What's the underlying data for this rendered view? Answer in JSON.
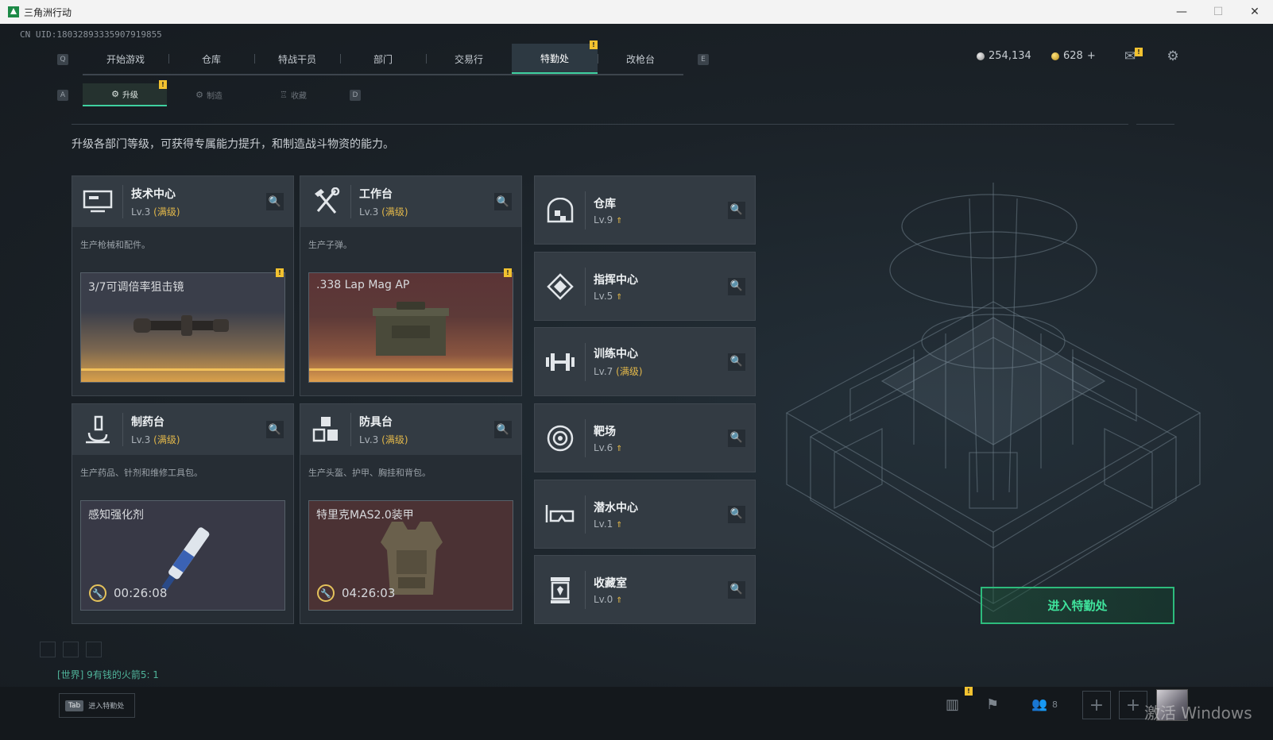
{
  "window": {
    "title": "三角洲行动",
    "minimize": "—",
    "maximize": "☐",
    "close": "✕"
  },
  "uid": "CN UID:18032893335907919855",
  "nav": {
    "left_key": "Q",
    "right_key": "E",
    "tabs": [
      {
        "label": "开始游戏"
      },
      {
        "label": "仓库"
      },
      {
        "label": "特战干员"
      },
      {
        "label": "部门"
      },
      {
        "label": "交易行"
      },
      {
        "label": "特勤处",
        "active": true,
        "badge": "!"
      },
      {
        "label": "改枪台"
      }
    ]
  },
  "currency": {
    "silver": "254,134",
    "gold": "628",
    "gold_add": "+"
  },
  "mail_badge": "!",
  "subnav": {
    "left_key": "A",
    "right_key": "D",
    "tabs": [
      {
        "label": "升级",
        "active": true,
        "badge": "!"
      },
      {
        "label": "制造"
      },
      {
        "label": "收藏"
      }
    ]
  },
  "description": "升级各部门等级，可获得专属能力提升，和制造战斗物资的能力。",
  "cards": [
    {
      "title": "技术中心",
      "level": "Lv.3",
      "max": "(满级)",
      "desc": "生产枪械和配件。",
      "product": "3/7可调倍率狙击镜",
      "badge": "!",
      "icon": "computer-icon"
    },
    {
      "title": "工作台",
      "level": "Lv.3",
      "max": "(满级)",
      "desc": "生产子弹。",
      "product": ".338 Lap Mag AP",
      "badge": "!",
      "icon": "tools-icon"
    },
    {
      "title": "制药台",
      "level": "Lv.3",
      "max": "(满级)",
      "desc": "生产药品、针剂和维修工具包。",
      "product": "感知强化剂",
      "timer": "00:26:08",
      "icon": "microscope-icon"
    },
    {
      "title": "防具台",
      "level": "Lv.3",
      "max": "(满级)",
      "desc": "生产头盔、护甲、胸挂和背包。",
      "product": "特里克MAS2.0装甲",
      "timer": "04:26:03",
      "icon": "cubes-icon"
    }
  ],
  "departments": [
    {
      "title": "仓库",
      "level": "Lv.9",
      "icon": "warehouse-icon"
    },
    {
      "title": "指挥中心",
      "level": "Lv.5",
      "icon": "command-icon"
    },
    {
      "title": "训练中心",
      "level": "Lv.7",
      "max": "(满级)",
      "icon": "dumbbell-icon"
    },
    {
      "title": "靶场",
      "level": "Lv.6",
      "icon": "target-icon"
    },
    {
      "title": "潜水中心",
      "level": "Lv.1",
      "icon": "diving-mask-icon"
    },
    {
      "title": "收藏室",
      "level": "Lv.0",
      "icon": "trophy-icon"
    }
  ],
  "enter_button": "进入特勤处",
  "chat": "[世界] 9有钱的火箭5: 1",
  "bottom": {
    "tab_key": "Tab",
    "tab_label": "进入特勤处",
    "friends_count": "8",
    "watermark": "激活 Windows"
  }
}
